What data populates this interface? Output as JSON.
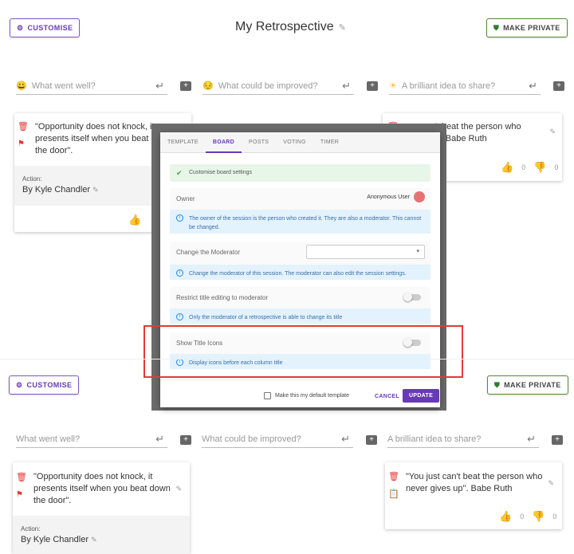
{
  "header": {
    "customise_label": "CUSTOMISE",
    "title": "My Retrospective",
    "make_private_label": "MAKE PRIVATE"
  },
  "columns": [
    {
      "placeholder": "What went well?",
      "icon": "😀"
    },
    {
      "placeholder": "What could be improved?",
      "icon": "😔"
    },
    {
      "placeholder": "A brilliant idea to share?",
      "icon": "☀"
    }
  ],
  "cards": {
    "card1": {
      "text_top": "\"Opportunity does not knock, it presents itself when you beat d",
      "text_top_line1": "\"Opportunity does not knock, it",
      "text_top_line2": "presents itself when you beat d",
      "text_top_line3": "the door\".",
      "action_label": "Action:",
      "action_value": "By Kyle Chandler",
      "upvotes": ""
    },
    "card2": {
      "line1": "'You just can't beat the person who",
      "line1_visible": "can't beat the person who",
      "line2_visible": "s up\". Babe Ruth",
      "upvotes": "0",
      "downvotes": "0"
    }
  },
  "dialog": {
    "tabs": [
      "TEMPLATE",
      "BOARD",
      "POSTS",
      "VOTING",
      "TIMER"
    ],
    "active_tab": "BOARD",
    "banner": "Customise board settings",
    "owner_label": "Owner",
    "owner_value": "Anonymous User",
    "owner_info": "The owner of the session is the person who created it. They are also a moderator. This cannot be changed.",
    "moderator_label": "Change the Moderator",
    "moderator_info": "Change the moderator of this session. The moderator can also edit the session settings.",
    "restrict_label": "Restrict title editing to moderator",
    "restrict_info": "Only the moderator of a retrospective is able to change its title",
    "show_icons_label": "Show Title Icons",
    "show_icons_info": "Display icons before each column title",
    "default_template_label": "Make this my default template",
    "cancel_label": "CANCEL",
    "update_label": "UPDATE"
  },
  "lower": {
    "customise_label": "CUSTOMISE",
    "make_private_label": "MAKE PRIVATE",
    "columns": [
      "What went well?",
      "What could be improved?",
      "A brilliant idea to share?"
    ],
    "card1_line1": "\"Opportunity does not knock, it",
    "card1_line2": "presents itself when you beat down",
    "card1_line3": "the door\".",
    "action_label": "Action:",
    "action_value": "By Kyle Chandler",
    "card2_line1": "\"You just can't beat the person who",
    "card2_line2": "never gives up\". Babe Ruth",
    "upvotes": "0",
    "downvotes": "0"
  },
  "colors": {
    "accent": "#673ab7",
    "highlight": "#e53935",
    "upvote": "#2e7d32",
    "downvote": "#c62828"
  }
}
